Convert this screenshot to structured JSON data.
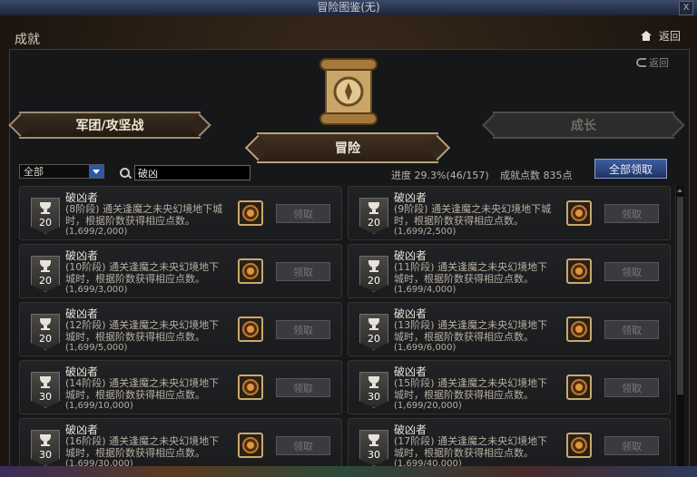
{
  "window": {
    "title": "冒险图鉴(无)",
    "close": "X"
  },
  "header": {
    "title": "成就",
    "back_label": "返回"
  },
  "panel": {
    "back_label": "返回"
  },
  "tabs": {
    "left": "军团/攻坚战",
    "center": "冒险",
    "right": "成长"
  },
  "filter": {
    "selected": "全部"
  },
  "search": {
    "value": "破凶"
  },
  "stats": {
    "progress": "进度 29.3%(46/157)",
    "points": "成就点数 835点"
  },
  "claim_all_label": "全部领取",
  "cards": [
    {
      "title": "破凶者",
      "desc": "(8阶段) 通关逢魔之未央幻境地下城时，根据阶数获得相应点数。",
      "progress": "(1,699/2,000)",
      "level": "20",
      "button": "领取"
    },
    {
      "title": "破凶者",
      "desc": "(9阶段) 通关逢魔之未央幻境地下城时，根据阶数获得相应点数。",
      "progress": "(1,699/2,500)",
      "level": "20",
      "button": "领取"
    },
    {
      "title": "破凶者",
      "desc": "(10阶段) 通关逢魔之未央幻境地下城时，根据阶数获得相应点数。",
      "progress": "(1,699/3,000)",
      "level": "20",
      "button": "领取"
    },
    {
      "title": "破凶者",
      "desc": "(11阶段) 通关逢魔之未央幻境地下城时，根据阶数获得相应点数。",
      "progress": "(1,699/4,000)",
      "level": "20",
      "button": "领取"
    },
    {
      "title": "破凶者",
      "desc": "(12阶段) 通关逢魔之未央幻境地下城时，根据阶数获得相应点数。",
      "progress": "(1,699/5,000)",
      "level": "20",
      "button": "领取"
    },
    {
      "title": "破凶者",
      "desc": "(13阶段) 通关逢魔之未央幻境地下城时，根据阶数获得相应点数。",
      "progress": "(1,699/6,000)",
      "level": "20",
      "button": "领取"
    },
    {
      "title": "破凶者",
      "desc": "(14阶段) 通关逢魔之未央幻境地下城时，根据阶数获得相应点数。",
      "progress": "(1,699/10,000)",
      "level": "30",
      "button": "领取"
    },
    {
      "title": "破凶者",
      "desc": "(15阶段) 通关逢魔之未央幻境地下城时，根据阶数获得相应点数。",
      "progress": "(1,699/20,000)",
      "level": "30",
      "button": "领取"
    },
    {
      "title": "破凶者",
      "desc": "(16阶段) 通关逢魔之未央幻境地下城时，根据阶数获得相应点数。",
      "progress": "(1,699/30,000)",
      "level": "30",
      "button": "领取"
    },
    {
      "title": "破凶者",
      "desc": "(17阶段) 通关逢魔之未央幻境地下城时，根据阶数获得相应点数。",
      "progress": "(1,699/40,000)",
      "level": "30",
      "button": "领取"
    }
  ],
  "icons": {
    "home": "home-icon",
    "back": "back-arrow-icon",
    "search": "search-icon",
    "trophy": "trophy-icon",
    "reward": "reward-emblem-icon",
    "scroll": "scroll-compass-icon"
  },
  "colors": {
    "accent_blue": "#2f56a6",
    "gold": "#c8aa6d"
  }
}
